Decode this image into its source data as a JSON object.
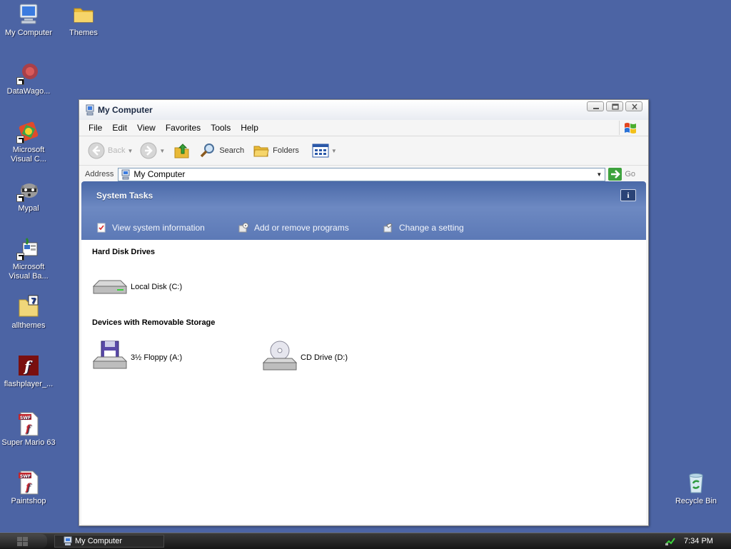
{
  "desktop": {
    "icons": [
      {
        "label": "My Computer",
        "icon": "my-computer-icon"
      },
      {
        "label": "Themes",
        "icon": "folder-icon"
      },
      {
        "label": "DataWago...",
        "icon": "datawagon-icon"
      },
      {
        "label": "Microsoft Visual C...",
        "icon": "visual-c-icon"
      },
      {
        "label": "Mypal",
        "icon": "raccoon-icon"
      },
      {
        "label": "Microsoft Visual Ba...",
        "icon": "visual-basic-icon"
      },
      {
        "label": "allthemes",
        "icon": "archive-folder-icon"
      },
      {
        "label": "flashplayer_...",
        "icon": "flash-player-icon"
      },
      {
        "label": "Super Mario 63",
        "icon": "swf-file-icon"
      },
      {
        "label": "Paintshop",
        "icon": "swf-file-icon"
      },
      {
        "label": "Recycle Bin",
        "icon": "recycle-bin-icon"
      }
    ]
  },
  "window": {
    "title": "My Computer",
    "menu": [
      "File",
      "Edit",
      "View",
      "Favorites",
      "Tools",
      "Help"
    ],
    "toolbar": {
      "back": "Back",
      "search": "Search",
      "folders": "Folders"
    },
    "address": {
      "label": "Address",
      "value": "My Computer",
      "go": "Go"
    },
    "tasks": {
      "title": "System Tasks",
      "items": [
        "View system information",
        "Add or remove programs",
        "Change a setting"
      ]
    },
    "groups": [
      {
        "title": "Hard Disk Drives",
        "items": [
          "Local Disk (C:)"
        ]
      },
      {
        "title": "Devices with Removable Storage",
        "items": [
          "3½ Floppy (A:)",
          "CD Drive (D:)"
        ]
      }
    ]
  },
  "taskbar": {
    "tasks": [
      "My Computer"
    ],
    "clock": "7:34 PM"
  },
  "colors": {
    "desktop": "#4c64a4",
    "tasks_pane": "#5c79b6",
    "taskbar": "#1e1e1e"
  }
}
